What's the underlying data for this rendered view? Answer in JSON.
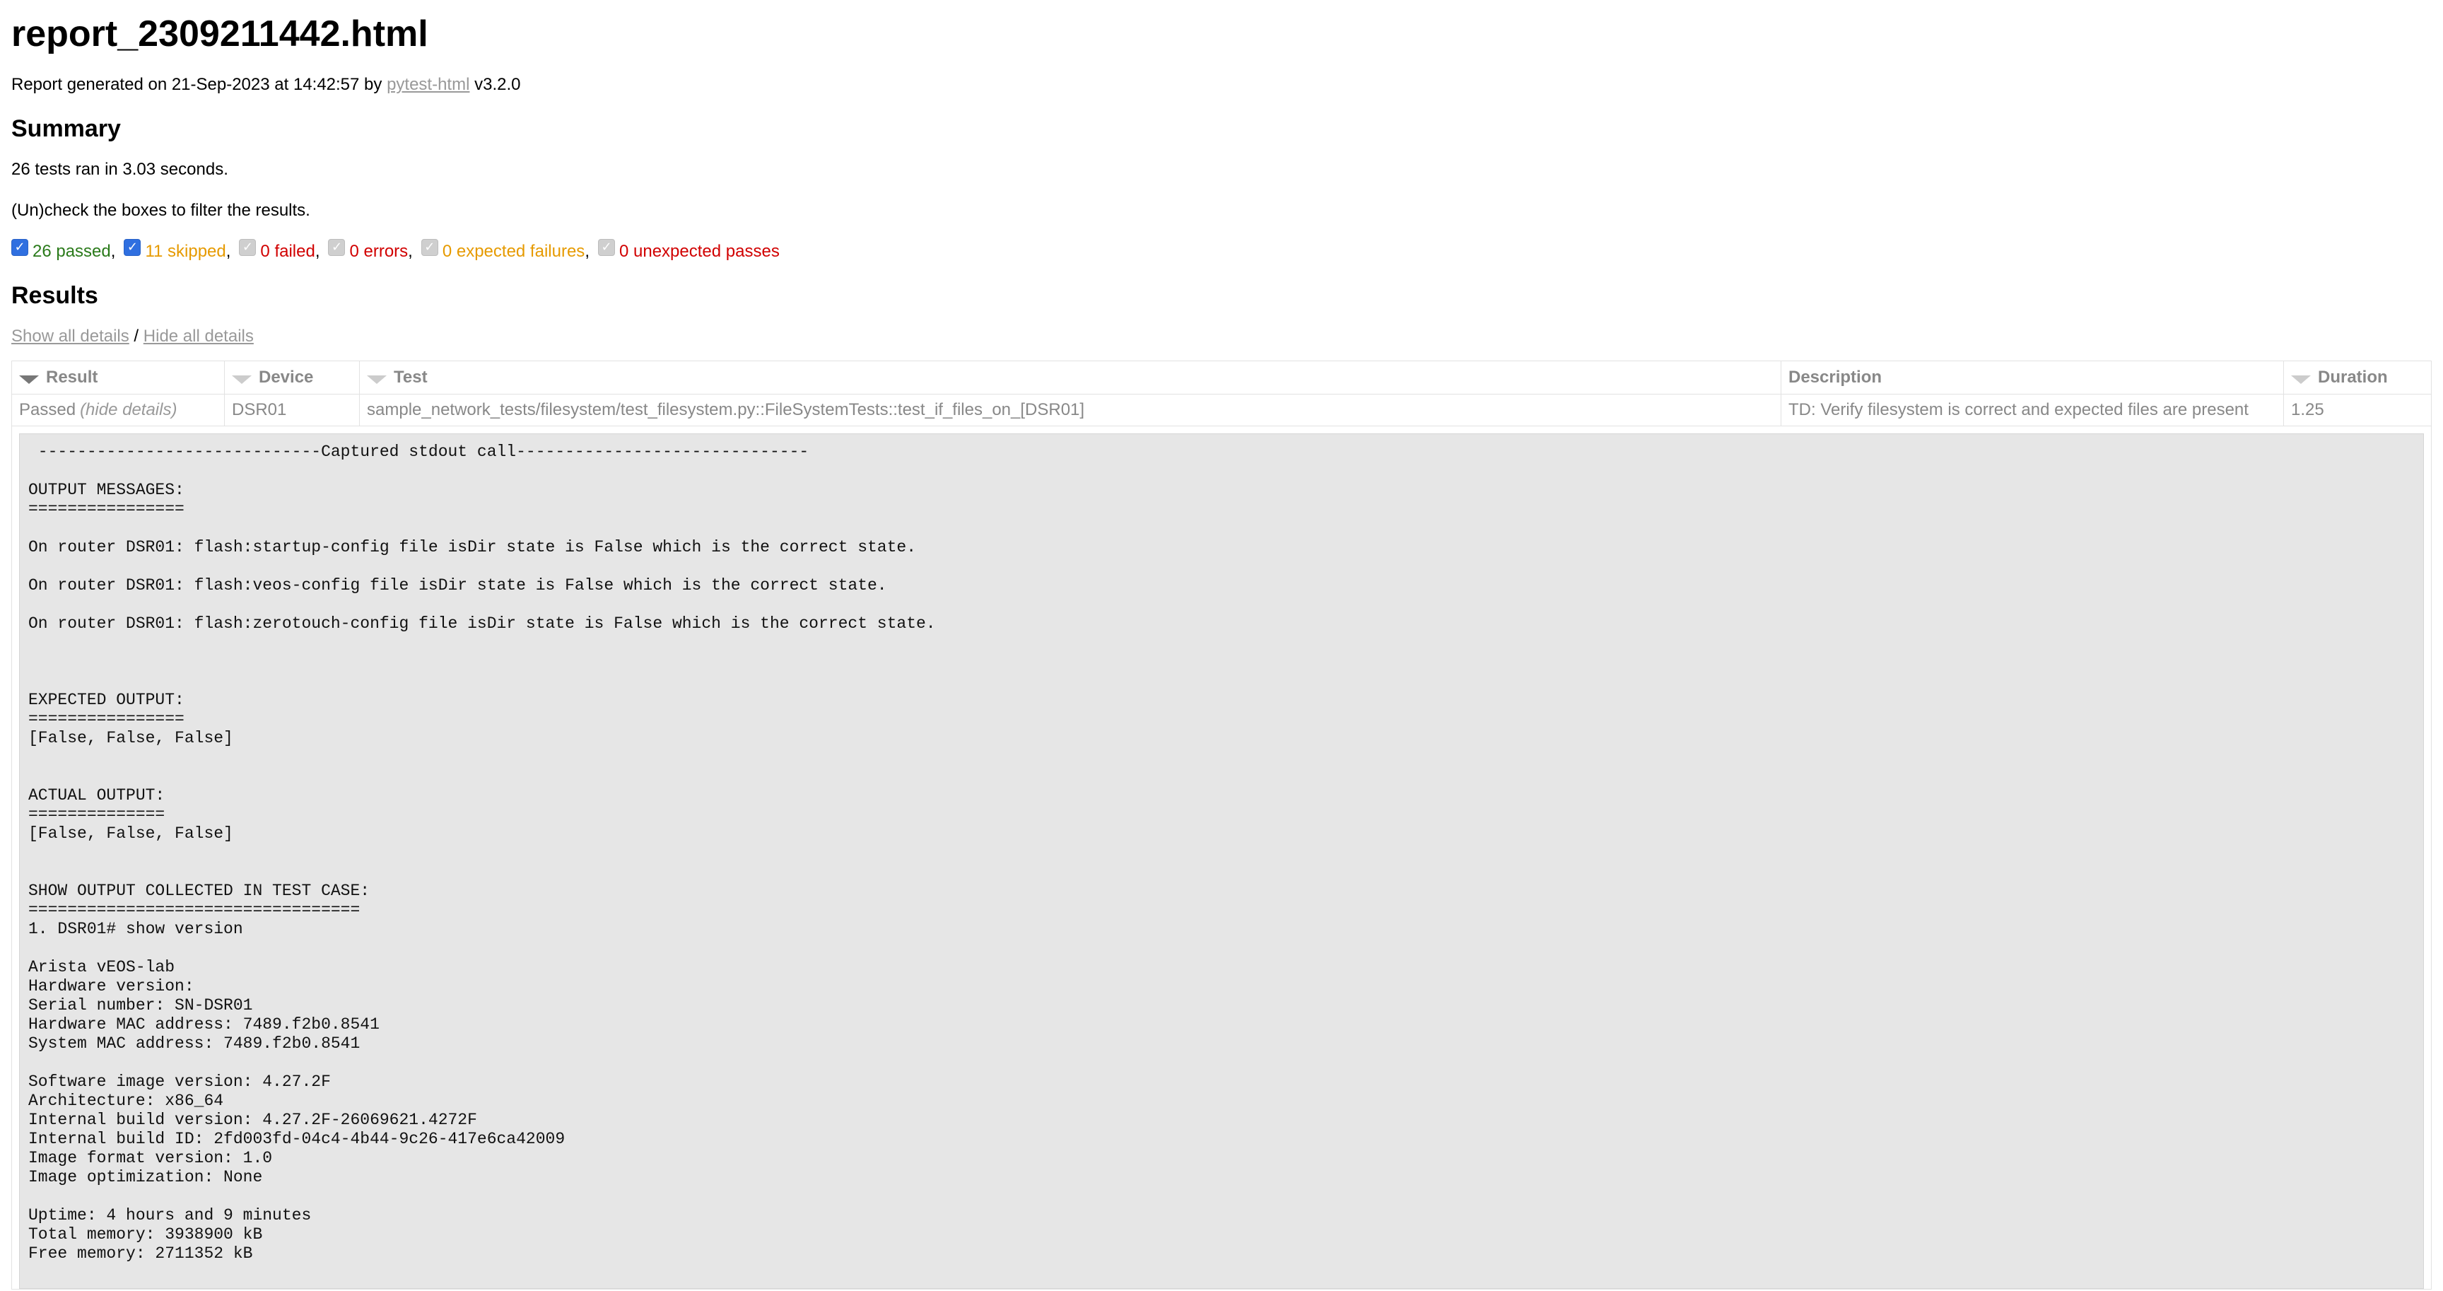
{
  "title": "report_2309211442.html",
  "generated": {
    "prefix": "Report generated on 21-Sep-2023 at 14:42:57 by ",
    "tool_link": "pytest-html",
    "suffix": " v3.2.0"
  },
  "summary": {
    "heading": "Summary",
    "ran_line": "26 tests ran in 3.03 seconds.",
    "filter_hint": "(Un)check the boxes to filter the results.",
    "filters": [
      {
        "label": "26 passed",
        "checked": true,
        "status": "passed"
      },
      {
        "label": "11 skipped",
        "checked": true,
        "status": "skipped"
      },
      {
        "label": "0 failed",
        "checked": false,
        "status": "failed"
      },
      {
        "label": "0 errors",
        "checked": false,
        "status": "failed"
      },
      {
        "label": "0 expected failures",
        "checked": false,
        "status": "xfail"
      },
      {
        "label": "0 unexpected passes",
        "checked": false,
        "status": "failed"
      }
    ]
  },
  "results": {
    "heading": "Results",
    "show_all": "Show all details",
    "separator": " / ",
    "hide_all": "Hide all details",
    "columns": [
      "Result",
      "Device",
      "Test",
      "Description",
      "Duration"
    ],
    "row": {
      "result": "Passed",
      "hide_details": "(hide details)",
      "device": "DSR01",
      "test": "sample_network_tests/filesystem/test_filesystem.py::FileSystemTests::test_if_files_on_[DSR01]",
      "description": "TD: Verify filesystem is correct and expected files are present",
      "duration": "1.25"
    },
    "log": " -----------------------------Captured stdout call------------------------------\n\nOUTPUT MESSAGES:\n================\n\nOn router DSR01: flash:startup-config file isDir state is False which is the correct state.\n\nOn router DSR01: flash:veos-config file isDir state is False which is the correct state.\n\nOn router DSR01: flash:zerotouch-config file isDir state is False which is the correct state.\n\n\n\nEXPECTED OUTPUT:\n================\n[False, False, False]\n\n\nACTUAL OUTPUT:\n==============\n[False, False, False]\n\n\nSHOW OUTPUT COLLECTED IN TEST CASE:\n==================================\n1. DSR01# show version\n\nArista vEOS-lab\nHardware version:\nSerial number: SN-DSR01\nHardware MAC address: 7489.f2b0.8541\nSystem MAC address: 7489.f2b0.8541\n\nSoftware image version: 4.27.2F\nArchitecture: x86_64\nInternal build version: 4.27.2F-26069621.4272F\nInternal build ID: 2fd003fd-04c4-4b44-9c26-417e6ca42009\nImage format version: 1.0\nImage optimization: None\n\nUptime: 4 hours and 9 minutes\nTotal memory: 3938900 kB\nFree memory: 2711352 kB"
  }
}
